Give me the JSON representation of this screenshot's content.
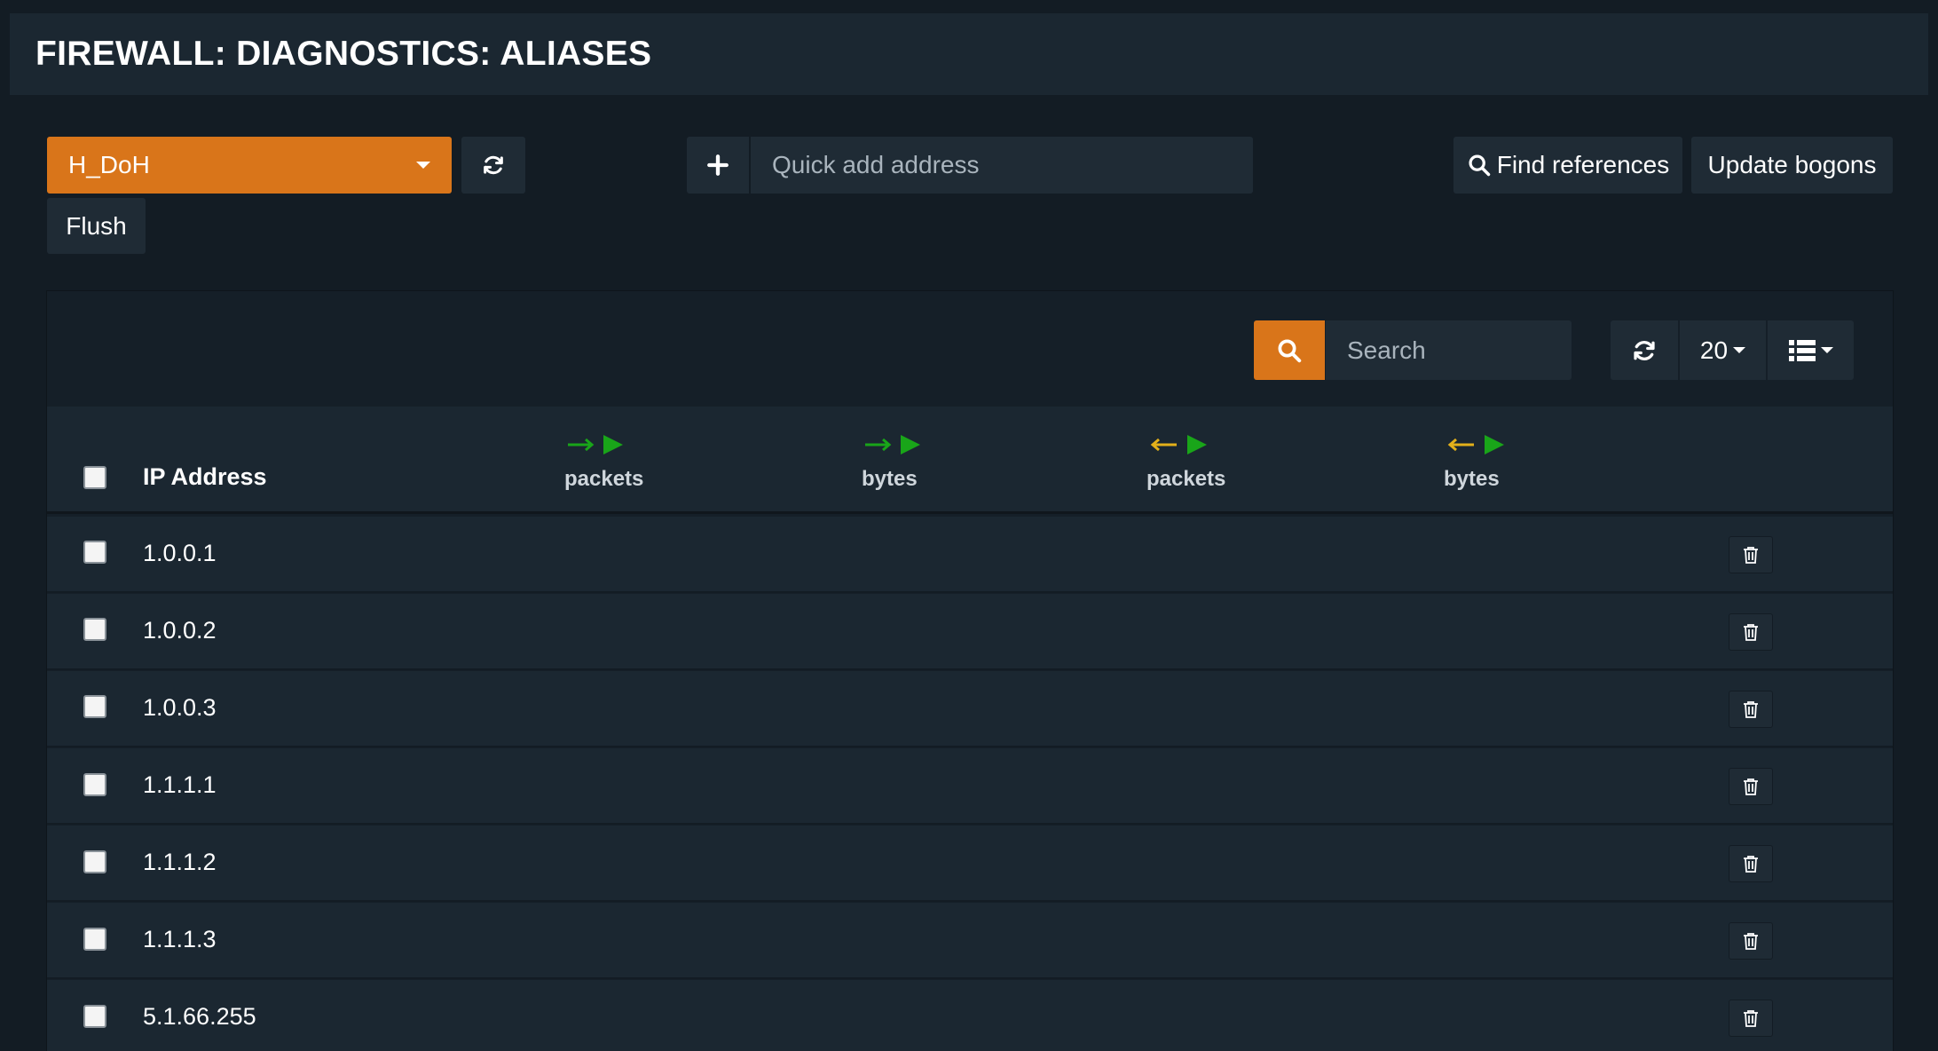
{
  "header": {
    "title": "FIREWALL: DIAGNOSTICS: ALIASES"
  },
  "toolbar": {
    "alias_selected": "H_DoH",
    "flush_label": "Flush",
    "quick_add_placeholder": "Quick add address",
    "find_references_label": "Find references",
    "update_bogons_label": "Update bogons"
  },
  "grid": {
    "search_placeholder": "Search",
    "page_size": "20",
    "columns": {
      "ip_address": "IP Address",
      "in_packets": "packets",
      "in_bytes": "bytes",
      "out_packets": "packets",
      "out_bytes": "bytes"
    },
    "rows": [
      {
        "ip": "1.0.0.1"
      },
      {
        "ip": "1.0.0.2"
      },
      {
        "ip": "1.0.0.3"
      },
      {
        "ip": "1.1.1.1"
      },
      {
        "ip": "1.1.1.2"
      },
      {
        "ip": "1.1.1.3"
      },
      {
        "ip": "5.1.66.255"
      }
    ]
  },
  "colors": {
    "accent": "#d9751a",
    "background": "#131c24",
    "panel": "#1b2731",
    "arrow_in": "#19a519",
    "arrow_out": "#e3b01a"
  },
  "icons": {
    "refresh": "refresh-icon",
    "plus": "plus-icon",
    "search": "search-icon",
    "list": "list-icon",
    "trash": "trash-icon",
    "arrow_right": "arrow-right-icon",
    "arrow_left": "arrow-left-icon",
    "play": "play-icon"
  }
}
